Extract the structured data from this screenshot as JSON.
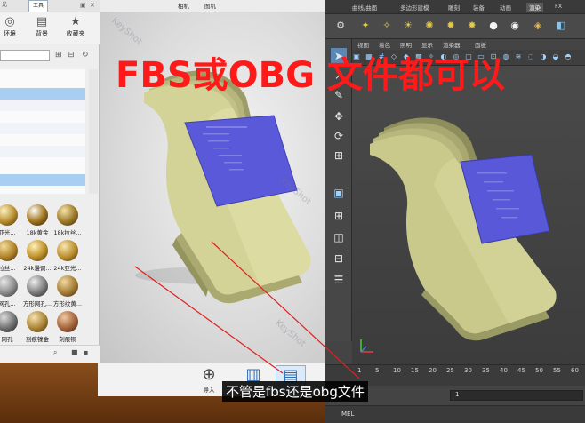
{
  "caption": {
    "headline": "FBS或OBG 文件都可以",
    "subtitle": "不管是fbs还是obg文件"
  },
  "keyshot": {
    "top_tabs": [
      "工具"
    ],
    "library_tabs": [
      {
        "label": "环境",
        "icon": "globe-icon"
      },
      {
        "label": "背景",
        "icon": "image-icon"
      },
      {
        "label": "收藏夹",
        "icon": "star-icon"
      }
    ],
    "menu": [
      "相机",
      "图机"
    ],
    "watermark": "KeyShot",
    "materials": [
      [
        "亚光...",
        "18k黄金",
        "18k拉丝..."
      ],
      [
        "拉丝...",
        "24k漫调...",
        "24k亚光..."
      ],
      [
        "网孔...",
        "方形网孔...",
        "方形纹黄..."
      ],
      [
        "网孔",
        "刻痕镍金",
        "刻痕铜"
      ]
    ],
    "dock": {
      "import_label": "导入"
    }
  },
  "maya": {
    "shelf_tabs": [
      "曲线/曲面",
      "多边形建模",
      "雕刻",
      "装备",
      "动画",
      "渲染",
      "FX",
      "FX 缓存"
    ],
    "active_shelf_tab": "渲染",
    "panel_menu": [
      "视图",
      "着色",
      "照明",
      "显示",
      "渲染器",
      "面板"
    ],
    "timeline_ticks": [
      "1",
      "5",
      "10",
      "15",
      "20",
      "25",
      "30",
      "35",
      "40",
      "45",
      "50",
      "55",
      "60"
    ],
    "range_start": "1",
    "range_end": "1",
    "command_label": "MEL"
  },
  "colors": {
    "caption_red": "#ff1a1a",
    "model_green": "#c9c98c",
    "screen_blue": "#5858d8",
    "maya_bg": "#444444"
  }
}
